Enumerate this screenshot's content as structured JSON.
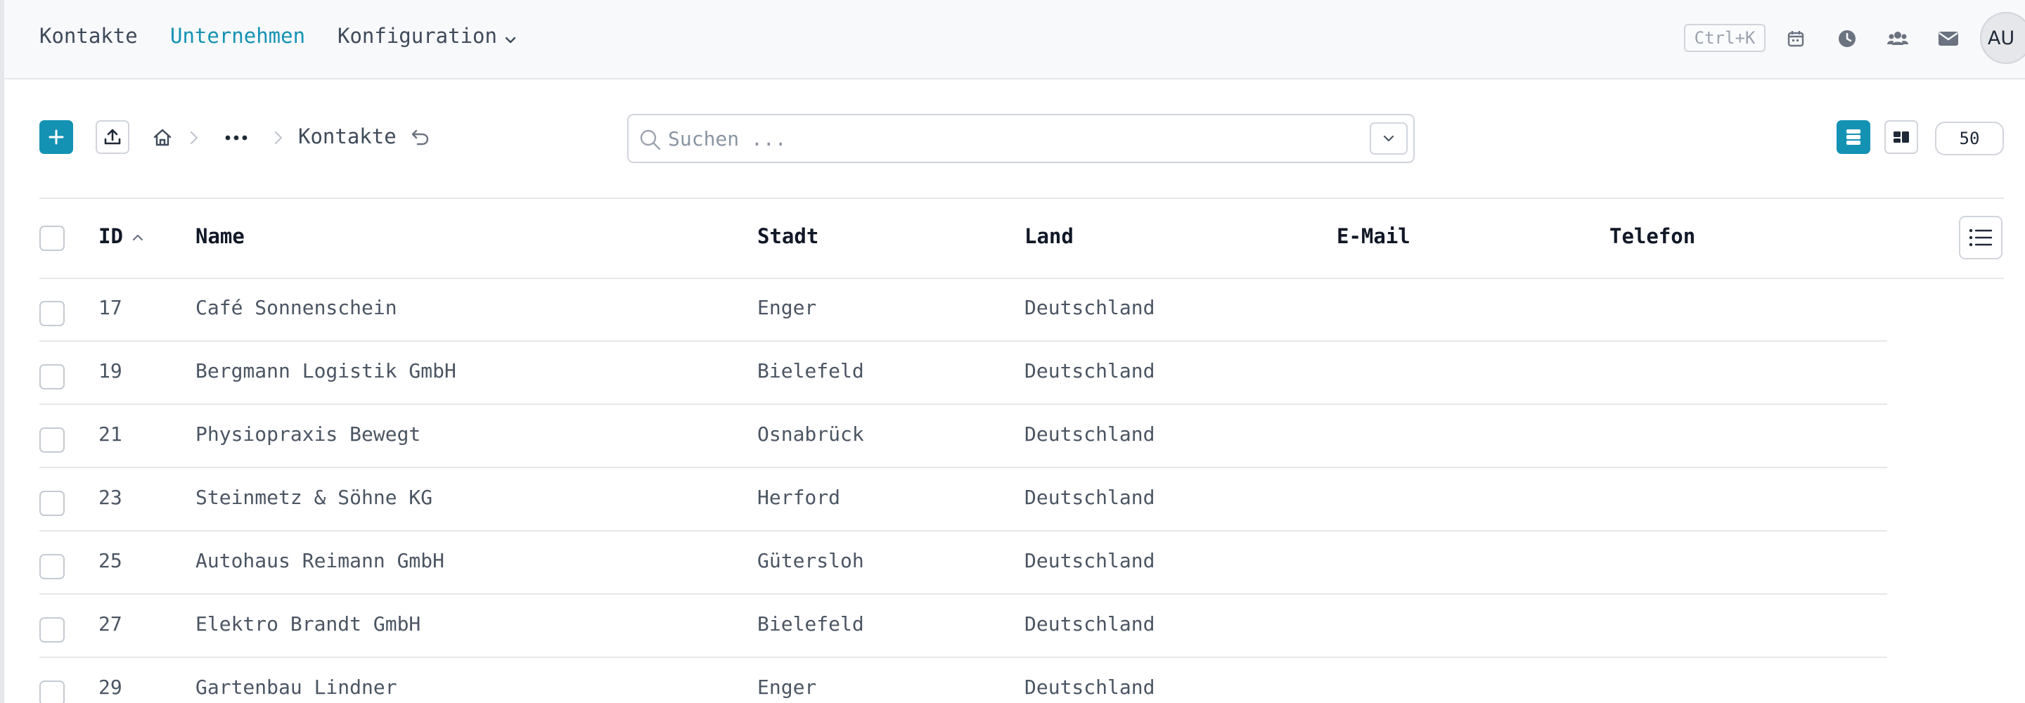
{
  "nav": {
    "items": [
      {
        "label": "Kontakte"
      },
      {
        "label": "Unternehmen"
      },
      {
        "label": "Konfiguration"
      }
    ],
    "shortcut": "Ctrl+K",
    "icons": [
      "calendar-icon",
      "clock-icon",
      "users-icon",
      "mail-icon"
    ],
    "avatar_initials": "AU",
    "accent_color": "#1492b4"
  },
  "toolbar": {
    "breadcrumb_current": "Kontakte",
    "search_placeholder": "Suchen ...",
    "search_value": "",
    "page_size": "50"
  },
  "table": {
    "headers": {
      "id": "ID",
      "name": "Name",
      "city": "Stadt",
      "country": "Land",
      "email": "E-Mail",
      "phone": "Telefon"
    },
    "sort": {
      "column": "ID",
      "direction": "ascending"
    },
    "rows": [
      {
        "id": "17",
        "name": "Café Sonnenschein",
        "city": "Enger",
        "country": "Deutschland",
        "email": "",
        "phone": ""
      },
      {
        "id": "19",
        "name": "Bergmann Logistik GmbH",
        "city": "Bielefeld",
        "country": "Deutschland",
        "email": "",
        "phone": ""
      },
      {
        "id": "21",
        "name": "Physiopraxis Bewegt",
        "city": "Osnabrück",
        "country": "Deutschland",
        "email": "",
        "phone": ""
      },
      {
        "id": "23",
        "name": "Steinmetz & Söhne KG",
        "city": "Herford",
        "country": "Deutschland",
        "email": "",
        "phone": ""
      },
      {
        "id": "25",
        "name": "Autohaus Reimann GmbH",
        "city": "Gütersloh",
        "country": "Deutschland",
        "email": "",
        "phone": ""
      },
      {
        "id": "27",
        "name": "Elektro Brandt GmbH",
        "city": "Bielefeld",
        "country": "Deutschland",
        "email": "",
        "phone": ""
      },
      {
        "id": "29",
        "name": "Gartenbau Lindner",
        "city": "Enger",
        "country": "Deutschland",
        "email": "",
        "phone": ""
      }
    ]
  }
}
